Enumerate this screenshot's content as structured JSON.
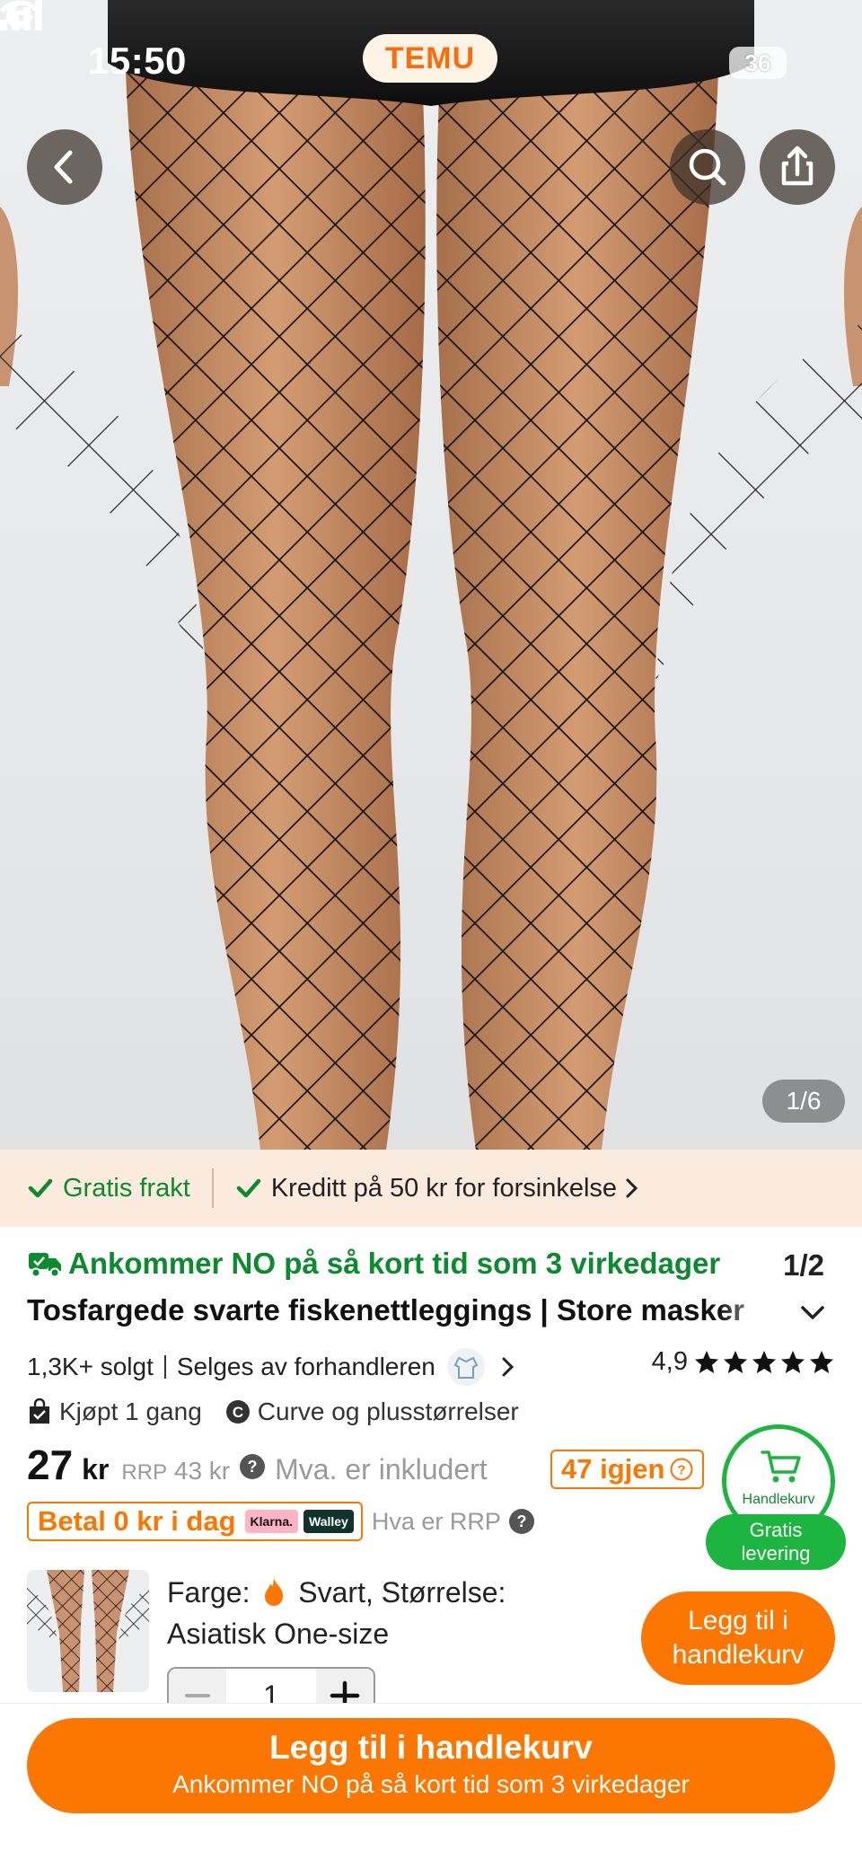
{
  "status_bar": {
    "time": "15:50",
    "app_pill": "TEMU",
    "battery": "36"
  },
  "gallery": {
    "counter": "1/6"
  },
  "benefits": {
    "free_shipping": "Gratis frakt",
    "credit": "Kreditt på 50 kr for forsinkelse"
  },
  "delivery": {
    "text": "Ankommer NO på så kort tid som 3 virkedager",
    "page": "1/2"
  },
  "product": {
    "title": "Tosfargede svarte fiskenettleggings | Store masker",
    "sold": "1,3K+ solgt",
    "seller": "Selges av forhandleren",
    "rating": "4,9",
    "stars": 5,
    "bought": "Kjøpt 1 gang",
    "tag": "Curve og plusstørrelser"
  },
  "price": {
    "amount": "27",
    "currency": "kr",
    "rrp_label": "RRP",
    "rrp_value": "43 kr",
    "vat": "Mva. er inkludert",
    "stock": "47 igjen"
  },
  "payment": {
    "text": "Betal 0 kr i dag",
    "klarna": "Klarna.",
    "walley": "Walley",
    "rrp_what": "Hva er RRP"
  },
  "cart_fab": {
    "label": "Handlekurv",
    "badge_line1": "Gratis",
    "badge_line2": "levering"
  },
  "variant": {
    "color_label": "Farge:",
    "color_value": "Svart,",
    "size_label": "Størrelse:",
    "size_value": "Asiatisk One-size",
    "add_line1": "Legg til i",
    "add_line2": "handlekurv",
    "quantity": "1"
  },
  "bottom": {
    "button_title": "Legg til i handlekurv",
    "button_sub": "Ankommer NO på så kort tid som 3 virkedager"
  },
  "colors": {
    "accent": "#fb7701",
    "green": "#0b8a2e",
    "fab_green": "#1cb53f"
  }
}
